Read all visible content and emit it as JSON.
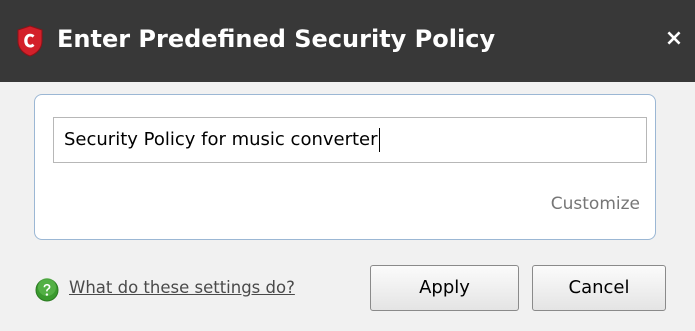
{
  "dialog": {
    "title": "Enter Predefined Security Policy",
    "close_icon": "close-icon",
    "logo_icon": "comodo-shield-logo"
  },
  "policy": {
    "name_value": "Security Policy for music converter",
    "customize_label": "Customize"
  },
  "footer": {
    "help_icon": "help-question-icon",
    "help_link": "What do these settings do?",
    "apply_label": "Apply",
    "cancel_label": "Cancel"
  },
  "colors": {
    "titlebar": "#383838",
    "logo_red": "#d3202a",
    "help_green": "#3a9a2e",
    "panel_border": "#9bb7d4"
  }
}
